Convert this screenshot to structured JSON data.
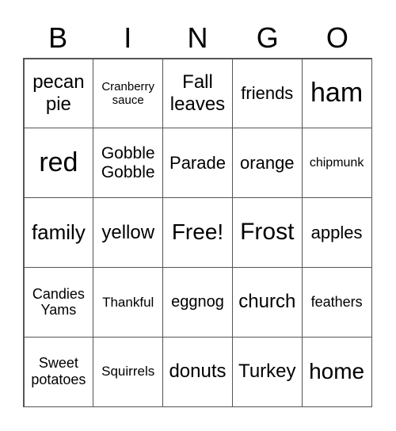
{
  "header": [
    "B",
    "I",
    "N",
    "G",
    "O"
  ],
  "cells": [
    "pecan pie",
    "Cranberry sauce",
    "Fall leaves",
    "friends",
    "ham",
    "red",
    "Gobble Gobble",
    "Parade",
    "orange",
    "chipmunk",
    "family",
    "yellow",
    "Free!",
    "Frost",
    "apples",
    "Candies Yams",
    "Thankful",
    "eggnog",
    "church",
    "feathers",
    "Sweet potatoes",
    "Squirrels",
    "donuts",
    "Turkey",
    "home"
  ]
}
